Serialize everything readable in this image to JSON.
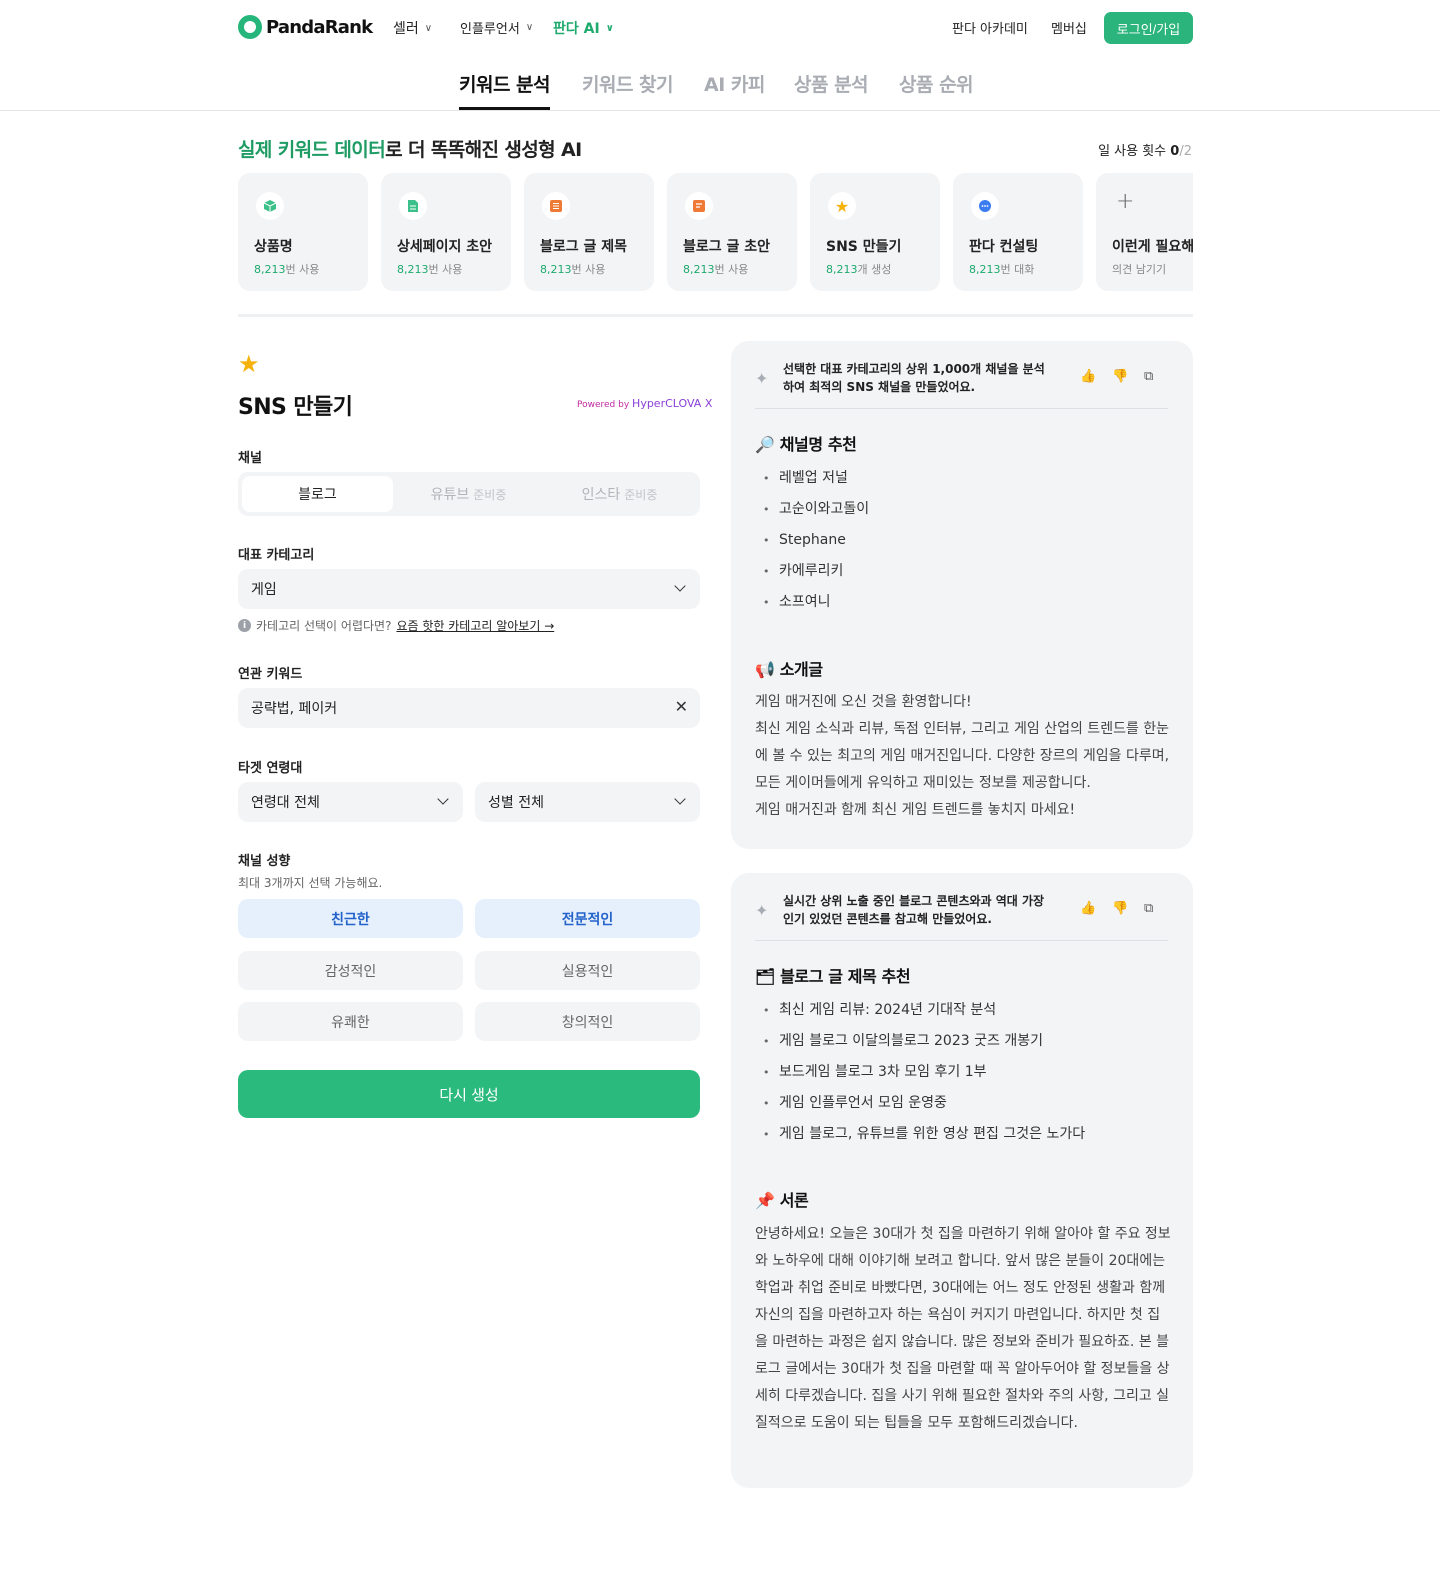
{
  "header": {
    "logo_text": "PandaRank",
    "nav": {
      "seller": "셀러",
      "influencer": "인플루언서",
      "ai": "판다 AI",
      "academy": "판다 아카데미",
      "membership": "멤버십"
    },
    "login": "로그인/가입"
  },
  "tabs": [
    "키워드 분석",
    "키워드 찾기",
    "AI 카피",
    "상품 분석",
    "상품 순위"
  ],
  "hero": {
    "headline_highlight": "실제 키워드 데이터",
    "headline_rest": "로 더 똑똑해진 생성형 AI",
    "usage_label": "일 사용 횟수",
    "usage_count": "0",
    "usage_max": "/2"
  },
  "tools": [
    {
      "icon": "cube-icon",
      "title": "상품명",
      "count": "8,213",
      "unit": "번 사용"
    },
    {
      "icon": "document-icon",
      "title": "상세페이지 초안",
      "count": "8,213",
      "unit": "번 사용"
    },
    {
      "icon": "list-icon",
      "title": "블로그 글 제목",
      "count": "8,213",
      "unit": "번 사용"
    },
    {
      "icon": "note-icon",
      "title": "블로그 글 초안",
      "count": "8,213",
      "unit": "번 사용"
    },
    {
      "icon": "star-icon",
      "title": "SNS 만들기",
      "count": "8,213",
      "unit": "개 생성"
    },
    {
      "icon": "chat-icon",
      "title": "판다 컨설팅",
      "count": "8,213",
      "unit": "번 대화"
    },
    {
      "icon": "plus-icon",
      "title": "이런게 필요해요",
      "count": "",
      "unit": "의견 남기기"
    }
  ],
  "form": {
    "title": "SNS 만들기",
    "powered_prefix": "Powered by",
    "powered_brand": "HyperCLOVA X",
    "channel_label": "채널",
    "channels": {
      "blog": "블로그",
      "youtube": "유튜브",
      "instagram": "인스타",
      "soon": "준비중"
    },
    "category_label": "대표 카테고리",
    "category_value": "게임",
    "helper_text": "카테고리 선택이 어렵다면?",
    "helper_link": "요즘 핫한 카테고리 알아보기 →",
    "keyword_label": "연관 키워드",
    "keyword_value": "공략법, 페이커",
    "target_label": "타겟 연령대",
    "age_value": "연령대 전체",
    "gender_value": "성별 전체",
    "tone_label": "채널 성향",
    "tone_help": "최대 3개까지 선택 가능해요.",
    "tones": [
      "친근한",
      "전문적인",
      "감성적인",
      "실용적인",
      "유쾌한",
      "창의적인"
    ],
    "regen": "다시 생성"
  },
  "panel1": {
    "head": "선택한 대표 카테고리의 상위 1,000개 채널을 분석하여 최적의 SNS 채널을 만들었어요.",
    "names_title": "채널명 추천",
    "names": [
      "레벨업 저널",
      "고순이와고돌이",
      "Stephane",
      "카에루리키",
      "소프여니"
    ],
    "intro_title": "소개글",
    "intro": "게임 매거진에 오신 것을 환영합니다!\n최신 게임 소식과 리뷰, 독점 인터뷰, 그리고 게임 산업의 트렌드를 한눈에 볼 수 있는 최고의 게임 매거진입니다. 다양한 장르의 게임을 다루며, 모든 게이머들에게 유익하고 재미있는 정보를 제공합니다.\n게임 매거진과 함께 최신 게임 트렌드를 놓치지 마세요!"
  },
  "panel2": {
    "head": "실시간 상위 노출 중인 블로그 콘텐츠와과 역대 가장 인기 있었던 콘텐츠를 참고해 만들었어요.",
    "titles_title": "블로그 글 제목 추천",
    "titles": [
      "최신 게임 리뷰: 2024년 기대작 분석",
      "게임 블로그 이달의블로그 2023 굿즈 개봉기",
      "보드게임 블로그 3차 모임 후기 1부",
      "게임 인플루언서 모임 운영중",
      "게임 블로그, 유튜브를 위한 영상 편집 그것은 노가다"
    ],
    "intro_title": "서론",
    "intro": "안녕하세요! 오늘은 30대가 첫 집을 마련하기 위해 알아야 할 주요 정보와 노하우에 대해 이야기해 보려고 합니다. 앞서 많은 분들이 20대에는 학업과 취업 준비로 바빴다면, 30대에는 어느 정도 안정된 생활과 함께 자신의 집을 마련하고자 하는 욕심이 커지기 마련입니다. 하지만 첫 집을 마련하는 과정은 쉽지 않습니다. 많은 정보와 준비가 필요하죠. 본 블로그 글에서는 30대가 첫 집을 마련할 때 꼭 알아두어야 할 정보들을 상세히 다루겠습니다. 집을 사기 위해 필요한 절차와 주의 사항, 그리고 실질적으로 도움이 되는 팁들을 모두 포함해드리겠습니다."
  },
  "colors": {
    "brand_green": "#2bb47b",
    "highlight_green": "#1f9c64",
    "selected_chip_bg": "#e6f0fd",
    "selected_chip_text": "#2463c9",
    "star": "#f5b20b"
  }
}
